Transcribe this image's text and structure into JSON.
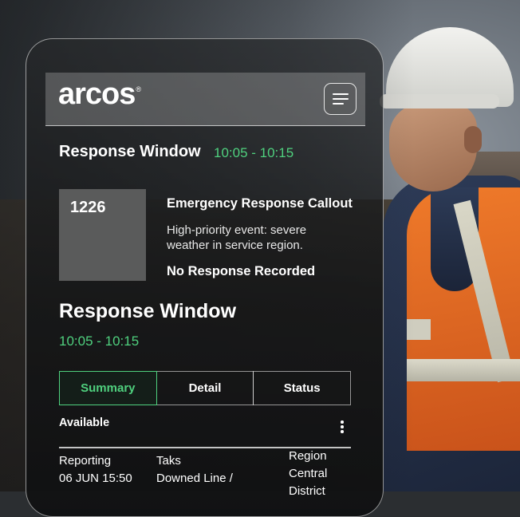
{
  "brand": {
    "logo_text": "arcos",
    "trademark": "®"
  },
  "header": {
    "menu_icon": "hamburger-menu-icon"
  },
  "top_window": {
    "label": "Response Window",
    "time": "10:05 - 10:15"
  },
  "event": {
    "id": "1226",
    "title": "Emergency Response Callout",
    "description": "High-priority event: severe weather in service region.",
    "status": "No Response Recorded"
  },
  "window": {
    "label": "Response Window",
    "time": "10:05 - 10:15"
  },
  "tabs": [
    {
      "label": "Summary",
      "active": true
    },
    {
      "label": "Detail",
      "active": false
    },
    {
      "label": "Status",
      "active": false
    }
  ],
  "section": {
    "label": "Available",
    "more_icon": "more-vertical-icon"
  },
  "details": {
    "reporting": {
      "label": "Reporting",
      "value": "06 JUN 15:50"
    },
    "task": {
      "label": "Taks",
      "value": "Downed Line /"
    },
    "region": {
      "label": "Region",
      "value_line1": "Central",
      "value_line2": "District"
    }
  },
  "colors": {
    "accent": "#4fd07e",
    "badge": "#5a5b5b",
    "text": "#ffffff"
  }
}
